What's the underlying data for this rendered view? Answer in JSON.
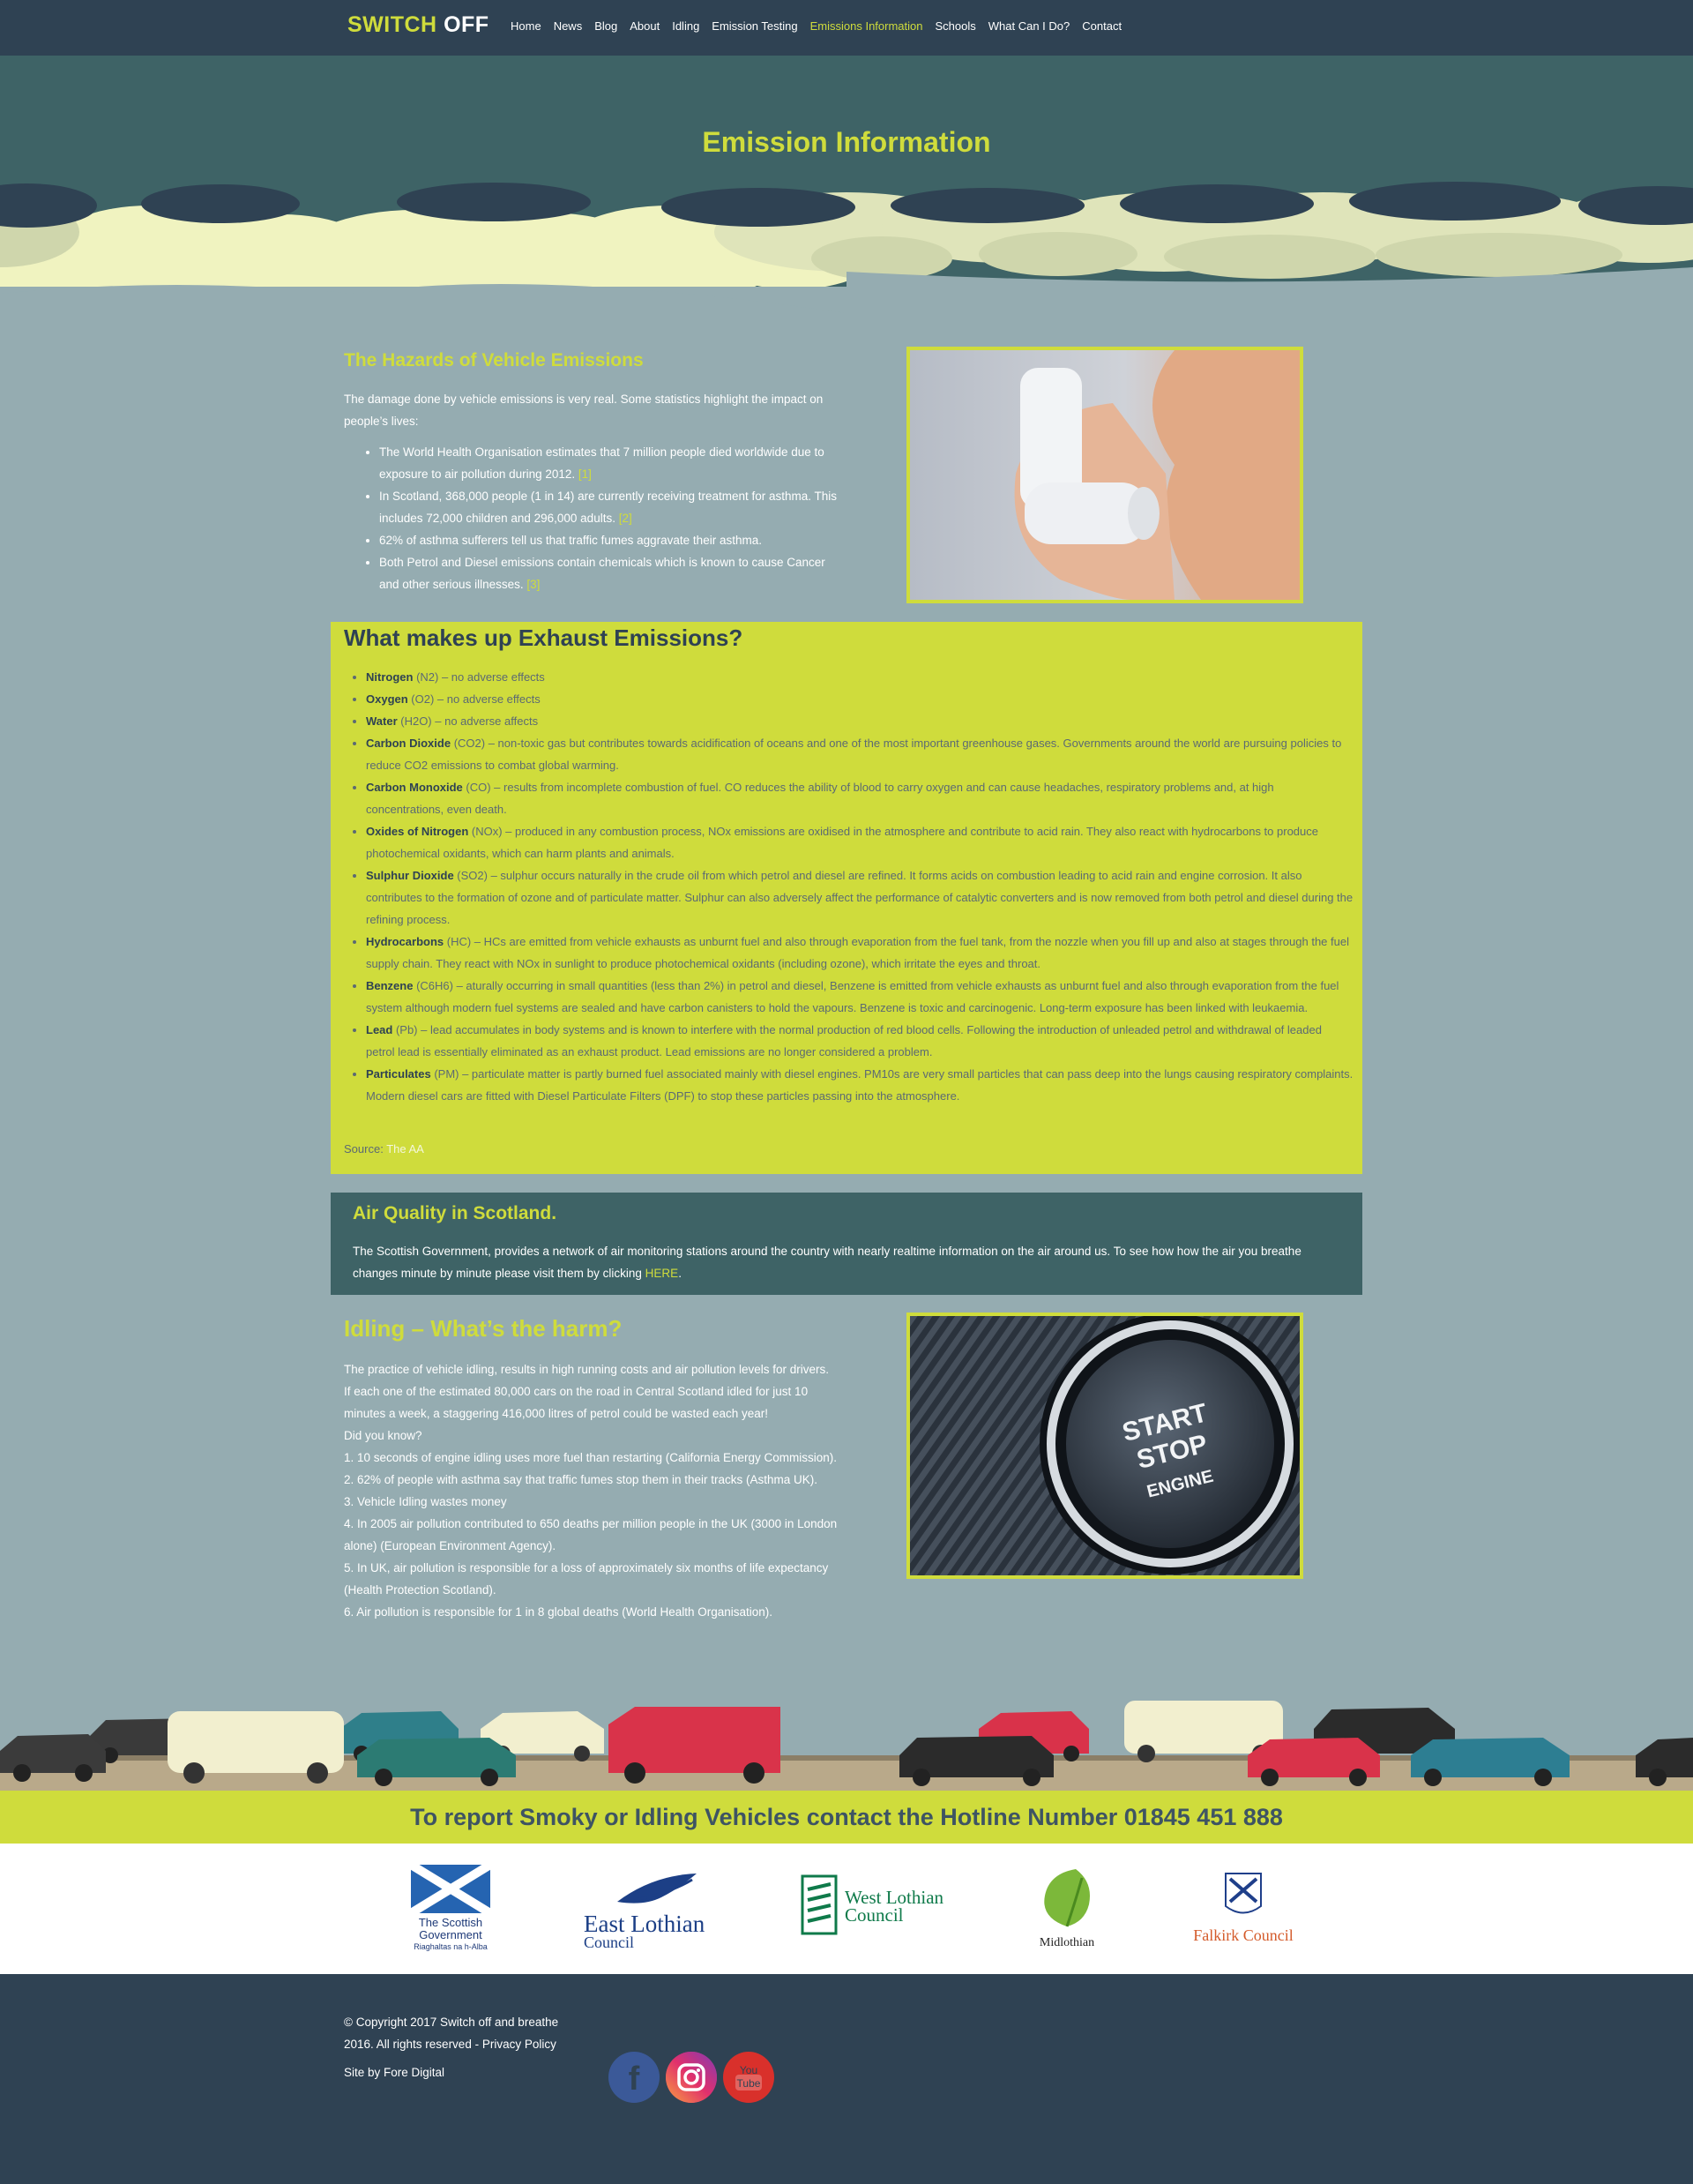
{
  "brand": {
    "logo_part1": "SWITCH",
    "logo_part2": "OFF"
  },
  "nav": {
    "items": [
      {
        "label": "Home"
      },
      {
        "label": "News"
      },
      {
        "label": "Blog"
      },
      {
        "label": "About"
      },
      {
        "label": "Idling"
      },
      {
        "label": "Emission Testing"
      },
      {
        "label": "Emissions Information",
        "active": true
      },
      {
        "label": "Schools"
      },
      {
        "label": "What Can I Do?"
      },
      {
        "label": "Contact"
      }
    ]
  },
  "hero": {
    "title": "Emission Information"
  },
  "hazards": {
    "title": "The Hazards of Vehicle Emissions",
    "intro": "The damage done by vehicle emissions is very real. Some statistics highlight the impact on people’s lives:",
    "items": [
      {
        "text": "The World Health Organisation estimates that 7 million people died worldwide due to exposure to air pollution during 2012.",
        "ref": "[1]"
      },
      {
        "text": " In Scotland, 368,000 people (1 in 14) are currently receiving treatment for asthma. This includes 72,000 children and 296,000 adults.",
        "ref": "[2]"
      },
      {
        "text": "62% of asthma sufferers tell us that traffic fumes aggravate their asthma.",
        "ref": ""
      },
      {
        "text": "Both Petrol and Diesel emissions contain chemicals which is known to cause Cancer and other serious illnesses.",
        "ref": "[3]"
      }
    ]
  },
  "exhaust": {
    "title": "What makes up Exhaust Emissions?",
    "items": [
      {
        "name": "Nitrogen",
        "text": " (N2) – no adverse effects"
      },
      {
        "name": "Oxygen",
        "text": " (O2) – no adverse effects"
      },
      {
        "name": "Water",
        "text": " (H2O) – no adverse affects"
      },
      {
        "name": "Carbon Dioxide",
        "text": " (CO2) – non-toxic gas but contributes towards acidification of oceans and one of the most important greenhouse gases. Governments around the world are pursuing policies to reduce CO2 emissions to combat global warming."
      },
      {
        "name": "Carbon Monoxide",
        "text": " (CO) – results from incomplete combustion of fuel. CO reduces the ability of blood to carry oxygen and can cause headaches, respiratory problems and, at high concentrations, even death."
      },
      {
        "name": "Oxides of Nitrogen",
        "text": " (NOx) – produced in any combustion process, NOx emissions are oxidised in the atmosphere and contribute to acid rain. They also react with hydrocarbons to produce photochemical oxidants, which can harm plants and animals."
      },
      {
        "name": "Sulphur Dioxide",
        "text": " (SO2) – sulphur occurs naturally in the crude oil from which petrol and diesel are refined. It forms acids on combustion leading to acid rain and engine corrosion. It also contributes to the formation of ozone and of particulate matter. Sulphur can also adversely affect the performance of catalytic converters and is now removed from both petrol and diesel during the refining process."
      },
      {
        "name": "Hydrocarbons",
        "text": " (HC) – HCs are emitted from vehicle exhausts as unburnt fuel and also through evaporation from the fuel tank, from the nozzle when you fill up and also at stages through the fuel supply chain. They react with NOx in sunlight to produce photochemical oxidants (including ozone), which irritate the eyes and throat."
      },
      {
        "name": "Benzene",
        "text": " (C6H6) – aturally occurring in small quantities (less than 2%) in petrol and diesel, Benzene is emitted from vehicle exhausts as unburnt fuel and also through evaporation from the fuel system although modern fuel systems are sealed and have carbon canisters to hold the vapours. Benzene is toxic and carcinogenic. Long-term exposure has been linked with leukaemia."
      },
      {
        "name": "Lead",
        "text": " (Pb) – lead accumulates in body systems and is known to interfere with the normal production of red blood cells. Following the introduction of unleaded petrol and withdrawal of leaded petrol lead is essentially eliminated as an exhaust product. Lead emissions are no longer considered a problem."
      },
      {
        "name": "Particulates",
        "text": " (PM) – particulate matter is partly burned fuel associated mainly with diesel engines. PM10s are very small particles that can pass deep into the lungs causing respiratory complaints. Modern diesel cars are fitted with Diesel Particulate Filters (DPF) to stop these particles passing into the atmosphere."
      }
    ],
    "source_label": "Source: ",
    "source_link": "The AA"
  },
  "air": {
    "title": "Air Quality in Scotland.",
    "text": "The Scottish Government, provides a network of air monitoring stations around the country with nearly realtime information on the air around us. To see how how the air you breathe changes minute by minute please visit them by clicking ",
    "link": "HERE",
    "after": "."
  },
  "idling": {
    "title": "Idling – What’s the harm?",
    "lines": [
      "The practice of vehicle idling, results in high running costs and air pollution levels for drivers.",
      "If each one of the estimated 80,000 cars on the road in Central Scotland idled for just 10 minutes a week, a staggering 416,000 litres of petrol could be wasted each year!",
      "Did you know?",
      "1. 10 seconds of engine idling uses more fuel than restarting (California Energy Commission).",
      "2. 62% of people with asthma say that traffic fumes stop them in their tracks (Asthma UK).",
      "3. Vehicle Idling wastes money",
      "4. In 2005 air pollution contributed to 650 deaths per million people in the UK (3000 in London alone) (European Environment Agency).",
      "5. In UK, air pollution is responsible for a loss of approximately six months of life expectancy (Health Protection Scotland).",
      "6. Air pollution is responsible for 1 in 8 global deaths (World Health Organisation)."
    ],
    "button_text": {
      "line1": "START",
      "line2": "STOP",
      "line3": "ENGINE"
    }
  },
  "hotline": {
    "text": "To report Smoky or Idling Vehicles contact the Hotline Number 01845 451 888"
  },
  "partners": {
    "scottish_gov": {
      "line1": "The Scottish",
      "line2": "Government",
      "line3": "Riaghaltas na h-Alba"
    },
    "east_lothian": {
      "line1": "East Lothian",
      "line2": "Council"
    },
    "west_lothian": {
      "line1": "West Lothian",
      "line2": "Council"
    },
    "midlothian": {
      "line1": "Midlothian"
    },
    "falkirk": {
      "line1": "Falkirk Council"
    }
  },
  "footer": {
    "copyright": "© Copyright 2017 Switch off and breathe 2016. All rights reserved - Privacy Policy",
    "credit": "Site by Fore Digital"
  },
  "social": [
    {
      "icon": "facebook-icon",
      "color": "#3b5998"
    },
    {
      "icon": "instagram-icon",
      "color": "#c13584"
    },
    {
      "icon": "youtube-icon",
      "color": "#d9302b"
    }
  ],
  "colors": {
    "accent": "#cfdc3c",
    "dark": "#2f4253",
    "teal": "#3e6366",
    "page": "#95acb1"
  }
}
